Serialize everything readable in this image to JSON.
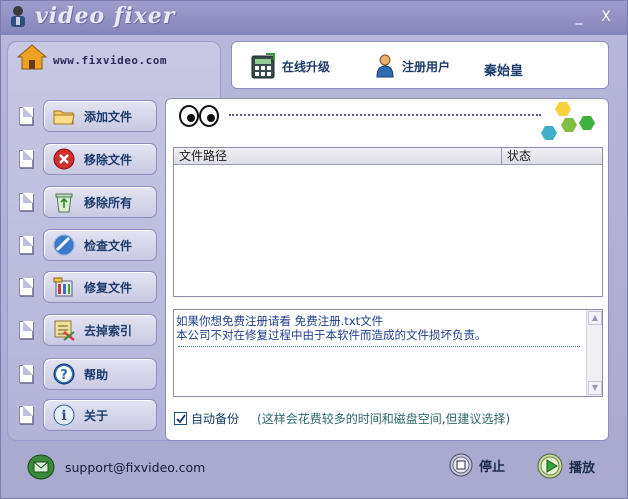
{
  "window": {
    "title": "video fixer",
    "minimize": "_",
    "close": "X"
  },
  "site": {
    "url": "www.fixvideo.com"
  },
  "header": {
    "upgrade_label": "在线升级",
    "register_label": "注册用户",
    "user_name": "秦始皇"
  },
  "sidebar": {
    "items": [
      {
        "label": "添加文件",
        "icon": "folder-icon"
      },
      {
        "label": "移除文件",
        "icon": "remove-icon"
      },
      {
        "label": "移除所有",
        "icon": "recycle-icon"
      },
      {
        "label": "检查文件",
        "icon": "inspect-icon"
      },
      {
        "label": "修复文件",
        "icon": "repair-icon"
      },
      {
        "label": "去掉索引",
        "icon": "remove-index-icon"
      },
      {
        "label": "帮助",
        "icon": "help-icon"
      },
      {
        "label": "关于",
        "icon": "info-icon"
      }
    ]
  },
  "table": {
    "columns": [
      "文件路径",
      "状态"
    ],
    "rows": []
  },
  "log": {
    "lines": [
      "如果你想免费注册请看  免费注册.txt文件",
      "本公司不对在修复过程中由于本软件而造成的文件损坏负责。"
    ]
  },
  "options": {
    "auto_backup_label": "自动备份",
    "auto_backup_checked": true,
    "auto_backup_note": "(这样会花费较多的时间和磁盘空间,但建议选择)"
  },
  "footer": {
    "support_email": "support@fixvideo.com",
    "stop_label": "停止",
    "play_label": "播放"
  },
  "colors": {
    "window_bg": "#b0b0d6",
    "panel": "#ffffff",
    "accent": "#1b3b6b",
    "log_text": "#1f3f8f"
  }
}
